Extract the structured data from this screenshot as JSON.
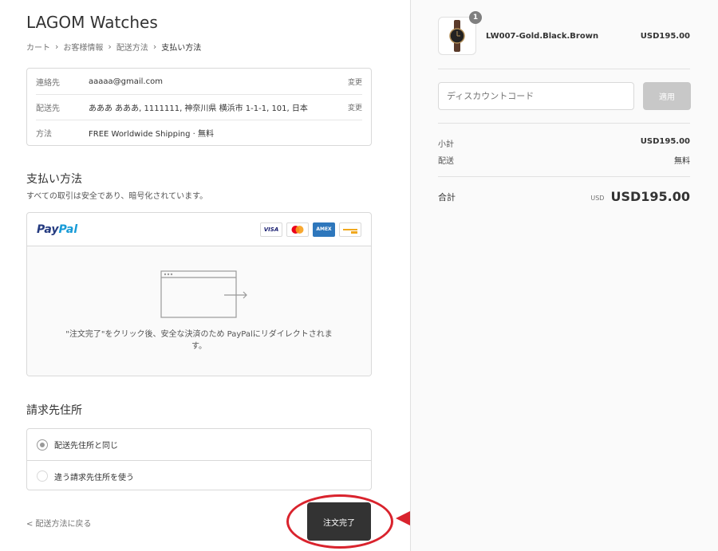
{
  "store": {
    "title": "LAGOM Watches"
  },
  "breadcrumb": [
    {
      "label": "カート"
    },
    {
      "label": "お客様情報"
    },
    {
      "label": "配送方法"
    },
    {
      "label": "支払い方法"
    }
  ],
  "review": {
    "contact": {
      "label": "連絡先",
      "value": "aaaaa@gmail.com",
      "change": "変更"
    },
    "ship_to": {
      "label": "配送先",
      "value": "あああ あああ, 1111111, 神奈川県 横浜市 1-1-1, 101, 日本",
      "change": "変更"
    },
    "method": {
      "label": "方法",
      "value": "FREE Worldwide Shipping · 無料"
    }
  },
  "payment": {
    "title": "支払い方法",
    "subtitle": "すべての取引は安全であり、暗号化されています。",
    "paypal_p1": "Pay",
    "paypal_p2": "Pal",
    "cards": {
      "visa": "VISA",
      "amex": "AMEX"
    },
    "redirect_text": "\"注文完了\"をクリック後、安全な決済のため PayPalにリダイレクトされます。"
  },
  "billing": {
    "title": "請求先住所",
    "options": [
      {
        "label": "配送先住所と同じ",
        "selected": true
      },
      {
        "label": "違う請求先住所を使う",
        "selected": false
      }
    ]
  },
  "nav": {
    "back": "< 配送方法に戻る",
    "complete": "注文完了"
  },
  "sidebar": {
    "product": {
      "qty": "1",
      "name": "LW007-Gold.Black.Brown",
      "price": "USD195.00"
    },
    "discount": {
      "placeholder": "ディスカウントコード",
      "apply": "適用"
    },
    "subtotal": {
      "label": "小計",
      "value": "USD195.00"
    },
    "shipping": {
      "label": "配送",
      "value": "無料"
    },
    "total": {
      "label": "合計",
      "currency": "USD",
      "value": "USD195.00"
    }
  },
  "colors": {
    "primary_button": "#333333",
    "annotation_red": "#d9232d",
    "sidebar_bg": "#fafafa"
  }
}
